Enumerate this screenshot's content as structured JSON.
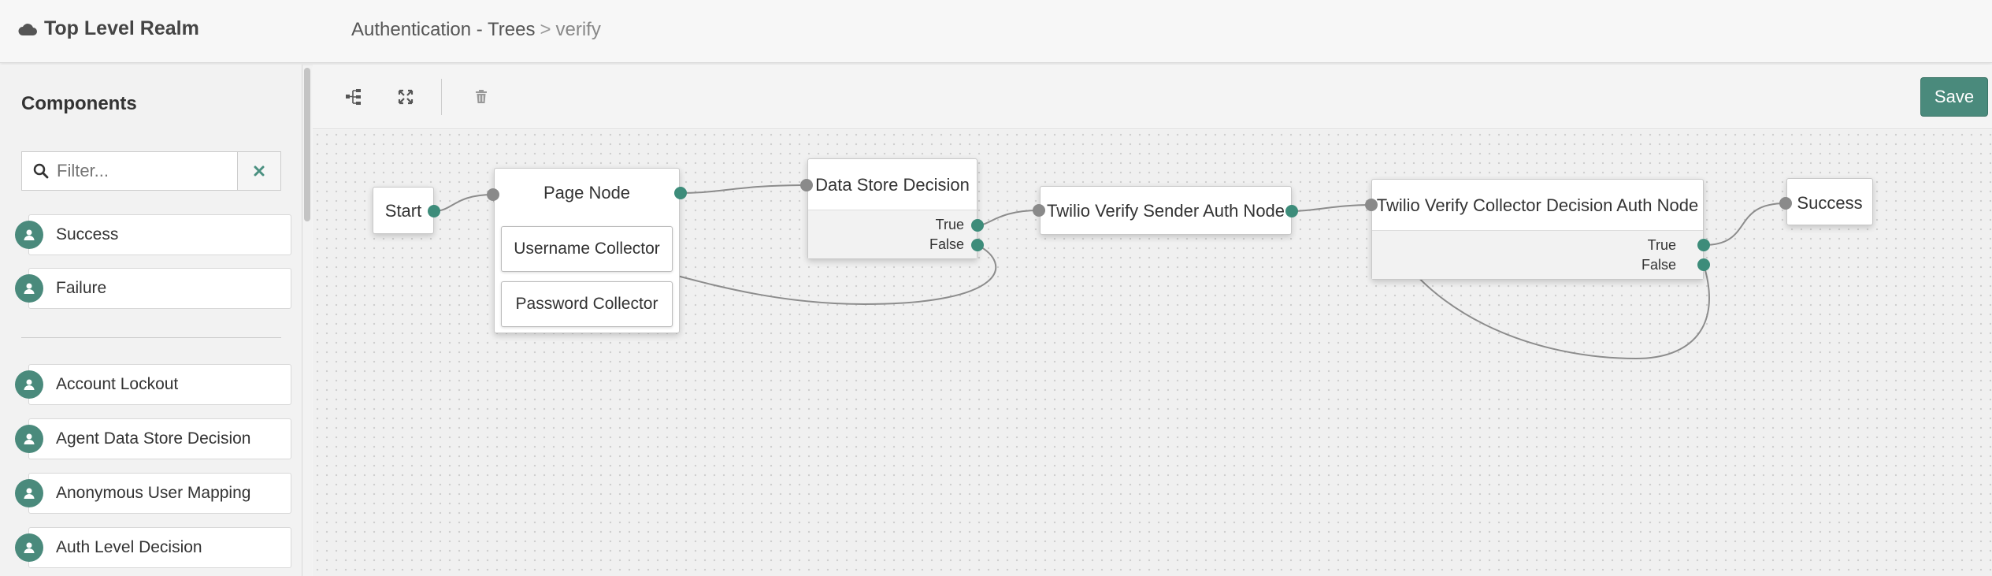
{
  "header": {
    "realm": "Top Level Realm",
    "breadcrumb_parent": "Authentication - Trees",
    "breadcrumb_separator": ">",
    "breadcrumb_current": "verify"
  },
  "sidebar": {
    "title": "Components",
    "filter_placeholder": "Filter...",
    "outcome_items": [
      {
        "label": "Success"
      },
      {
        "label": "Failure"
      }
    ],
    "node_items": [
      {
        "label": "Account Lockout"
      },
      {
        "label": "Agent Data Store Decision"
      },
      {
        "label": "Anonymous User Mapping"
      },
      {
        "label": "Auth Level Decision"
      }
    ]
  },
  "toolbar": {
    "icons": [
      "tree-layout-icon",
      "expand-icon",
      "trash-icon"
    ],
    "save_label": "Save"
  },
  "canvas": {
    "start": {
      "label": "Start"
    },
    "page_node": {
      "label": "Page Node",
      "children": [
        "Username Collector",
        "Password Collector"
      ]
    },
    "data_store": {
      "label": "Data Store Decision",
      "true": "True",
      "false": "False"
    },
    "sender": {
      "label": "Twilio Verify Sender Auth Node"
    },
    "collector": {
      "label": "Twilio Verify Collector Decision Auth Node",
      "true": "True",
      "false": "False"
    },
    "success": {
      "label": "Success"
    }
  },
  "colors": {
    "accent": "#4a8a7c",
    "port_out": "#3d8c7a",
    "port_in": "#8a8a8a"
  }
}
